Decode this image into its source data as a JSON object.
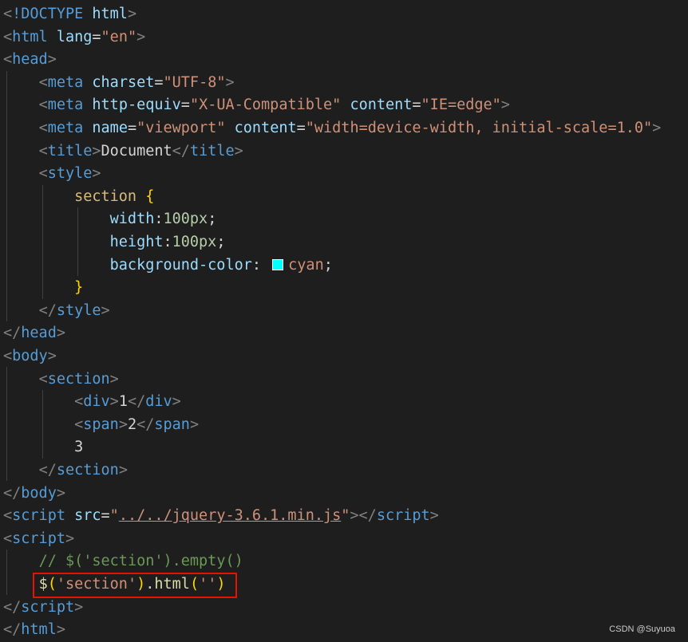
{
  "editor": {
    "lines": [
      {
        "indent": 0,
        "tokens": [
          {
            "t": "<",
            "c": "#808080"
          },
          {
            "t": "!DOCTYPE",
            "c": "#569cd6"
          },
          {
            "t": " ",
            "c": "#d4d4d4"
          },
          {
            "t": "html",
            "c": "#9cdcfe"
          },
          {
            "t": ">",
            "c": "#808080"
          }
        ]
      },
      {
        "indent": 0,
        "tokens": [
          {
            "t": "<",
            "c": "#808080"
          },
          {
            "t": "html",
            "c": "#569cd6"
          },
          {
            "t": " ",
            "c": "#d4d4d4"
          },
          {
            "t": "lang",
            "c": "#9cdcfe"
          },
          {
            "t": "=",
            "c": "#d4d4d4"
          },
          {
            "t": "\"en\"",
            "c": "#ce9178"
          },
          {
            "t": ">",
            "c": "#808080"
          }
        ]
      },
      {
        "indent": 0,
        "tokens": [
          {
            "t": "<",
            "c": "#808080"
          },
          {
            "t": "head",
            "c": "#569cd6"
          },
          {
            "t": ">",
            "c": "#808080"
          }
        ]
      },
      {
        "indent": 4,
        "tokens": [
          {
            "t": "<",
            "c": "#808080"
          },
          {
            "t": "meta",
            "c": "#569cd6"
          },
          {
            "t": " ",
            "c": "#d4d4d4"
          },
          {
            "t": "charset",
            "c": "#9cdcfe"
          },
          {
            "t": "=",
            "c": "#d4d4d4"
          },
          {
            "t": "\"UTF-8\"",
            "c": "#ce9178"
          },
          {
            "t": ">",
            "c": "#808080"
          }
        ]
      },
      {
        "indent": 4,
        "tokens": [
          {
            "t": "<",
            "c": "#808080"
          },
          {
            "t": "meta",
            "c": "#569cd6"
          },
          {
            "t": " ",
            "c": "#d4d4d4"
          },
          {
            "t": "http-equiv",
            "c": "#9cdcfe"
          },
          {
            "t": "=",
            "c": "#d4d4d4"
          },
          {
            "t": "\"X-UA-Compatible\"",
            "c": "#ce9178"
          },
          {
            "t": " ",
            "c": "#d4d4d4"
          },
          {
            "t": "content",
            "c": "#9cdcfe"
          },
          {
            "t": "=",
            "c": "#d4d4d4"
          },
          {
            "t": "\"IE=edge\"",
            "c": "#ce9178"
          },
          {
            "t": ">",
            "c": "#808080"
          }
        ]
      },
      {
        "indent": 4,
        "tokens": [
          {
            "t": "<",
            "c": "#808080"
          },
          {
            "t": "meta",
            "c": "#569cd6"
          },
          {
            "t": " ",
            "c": "#d4d4d4"
          },
          {
            "t": "name",
            "c": "#9cdcfe"
          },
          {
            "t": "=",
            "c": "#d4d4d4"
          },
          {
            "t": "\"viewport\"",
            "c": "#ce9178"
          },
          {
            "t": " ",
            "c": "#d4d4d4"
          },
          {
            "t": "content",
            "c": "#9cdcfe"
          },
          {
            "t": "=",
            "c": "#d4d4d4"
          },
          {
            "t": "\"width=device-width, initial-scale=1.0\"",
            "c": "#ce9178"
          },
          {
            "t": ">",
            "c": "#808080"
          }
        ]
      },
      {
        "indent": 4,
        "tokens": [
          {
            "t": "<",
            "c": "#808080"
          },
          {
            "t": "title",
            "c": "#569cd6"
          },
          {
            "t": ">",
            "c": "#808080"
          },
          {
            "t": "Document",
            "c": "#d4d4d4"
          },
          {
            "t": "</",
            "c": "#808080"
          },
          {
            "t": "title",
            "c": "#569cd6"
          },
          {
            "t": ">",
            "c": "#808080"
          }
        ]
      },
      {
        "indent": 4,
        "tokens": [
          {
            "t": "<",
            "c": "#808080"
          },
          {
            "t": "style",
            "c": "#569cd6"
          },
          {
            "t": ">",
            "c": "#808080"
          }
        ]
      },
      {
        "indent": 8,
        "tokens": [
          {
            "t": "section",
            "c": "#d7ba7d"
          },
          {
            "t": " ",
            "c": "#d4d4d4"
          },
          {
            "t": "{",
            "c": "#ffd700"
          }
        ]
      },
      {
        "indent": 12,
        "tokens": [
          {
            "t": "width",
            "c": "#9cdcfe"
          },
          {
            "t": ":",
            "c": "#d4d4d4"
          },
          {
            "t": "100",
            "c": "#b5cea8"
          },
          {
            "t": "px",
            "c": "#b5cea8"
          },
          {
            "t": ";",
            "c": "#d4d4d4"
          }
        ]
      },
      {
        "indent": 12,
        "tokens": [
          {
            "t": "height",
            "c": "#9cdcfe"
          },
          {
            "t": ":",
            "c": "#d4d4d4"
          },
          {
            "t": "100",
            "c": "#b5cea8"
          },
          {
            "t": "px",
            "c": "#b5cea8"
          },
          {
            "t": ";",
            "c": "#d4d4d4"
          }
        ]
      },
      {
        "indent": 12,
        "tokens": [
          {
            "t": "background-color",
            "c": "#9cdcfe"
          },
          {
            "t": ": ",
            "c": "#d4d4d4"
          },
          {
            "swatch": "#00ffff"
          },
          {
            "t": "cyan",
            "c": "#ce9178"
          },
          {
            "t": ";",
            "c": "#d4d4d4"
          }
        ]
      },
      {
        "indent": 8,
        "tokens": [
          {
            "t": "}",
            "c": "#ffd700"
          }
        ]
      },
      {
        "indent": 4,
        "tokens": [
          {
            "t": "</",
            "c": "#808080"
          },
          {
            "t": "style",
            "c": "#569cd6"
          },
          {
            "t": ">",
            "c": "#808080"
          }
        ]
      },
      {
        "indent": 0,
        "tokens": [
          {
            "t": "</",
            "c": "#808080"
          },
          {
            "t": "head",
            "c": "#569cd6"
          },
          {
            "t": ">",
            "c": "#808080"
          }
        ]
      },
      {
        "indent": 0,
        "tokens": [
          {
            "t": "<",
            "c": "#808080"
          },
          {
            "t": "body",
            "c": "#569cd6"
          },
          {
            "t": ">",
            "c": "#808080"
          }
        ]
      },
      {
        "indent": 4,
        "tokens": [
          {
            "t": "<",
            "c": "#808080"
          },
          {
            "t": "section",
            "c": "#569cd6"
          },
          {
            "t": ">",
            "c": "#808080"
          }
        ]
      },
      {
        "indent": 8,
        "tokens": [
          {
            "t": "<",
            "c": "#808080"
          },
          {
            "t": "div",
            "c": "#569cd6"
          },
          {
            "t": ">",
            "c": "#808080"
          },
          {
            "t": "1",
            "c": "#d4d4d4"
          },
          {
            "t": "</",
            "c": "#808080"
          },
          {
            "t": "div",
            "c": "#569cd6"
          },
          {
            "t": ">",
            "c": "#808080"
          }
        ]
      },
      {
        "indent": 8,
        "tokens": [
          {
            "t": "<",
            "c": "#808080"
          },
          {
            "t": "span",
            "c": "#569cd6"
          },
          {
            "t": ">",
            "c": "#808080"
          },
          {
            "t": "2",
            "c": "#d4d4d4"
          },
          {
            "t": "</",
            "c": "#808080"
          },
          {
            "t": "span",
            "c": "#569cd6"
          },
          {
            "t": ">",
            "c": "#808080"
          }
        ]
      },
      {
        "indent": 8,
        "tokens": [
          {
            "t": "3",
            "c": "#d4d4d4"
          }
        ]
      },
      {
        "indent": 4,
        "tokens": [
          {
            "t": "</",
            "c": "#808080"
          },
          {
            "t": "section",
            "c": "#569cd6"
          },
          {
            "t": ">",
            "c": "#808080"
          }
        ]
      },
      {
        "indent": 0,
        "tokens": [
          {
            "t": "</",
            "c": "#808080"
          },
          {
            "t": "body",
            "c": "#569cd6"
          },
          {
            "t": ">",
            "c": "#808080"
          }
        ]
      },
      {
        "indent": 0,
        "tokens": [
          {
            "t": "<",
            "c": "#808080"
          },
          {
            "t": "script",
            "c": "#569cd6"
          },
          {
            "t": " ",
            "c": "#d4d4d4"
          },
          {
            "t": "src",
            "c": "#9cdcfe"
          },
          {
            "t": "=",
            "c": "#d4d4d4"
          },
          {
            "t": "\"",
            "c": "#ce9178"
          },
          {
            "t": "../../jquery-3.6.1.min.js",
            "c": "#ce9178",
            "link": true
          },
          {
            "t": "\"",
            "c": "#ce9178"
          },
          {
            "t": "></",
            "c": "#808080"
          },
          {
            "t": "script",
            "c": "#569cd6"
          },
          {
            "t": ">",
            "c": "#808080"
          }
        ]
      },
      {
        "indent": 0,
        "tokens": [
          {
            "t": "<",
            "c": "#808080"
          },
          {
            "t": "script",
            "c": "#569cd6"
          },
          {
            "t": ">",
            "c": "#808080"
          }
        ]
      },
      {
        "indent": 4,
        "tokens": [
          {
            "t": "// $('section').empty()",
            "c": "#6a9955"
          }
        ]
      },
      {
        "indent": 4,
        "highlight": true,
        "tokens": [
          {
            "t": "$",
            "c": "#dcdcaa"
          },
          {
            "t": "(",
            "c": "#ffd700"
          },
          {
            "t": "'section'",
            "c": "#ce9178"
          },
          {
            "t": ")",
            "c": "#ffd700"
          },
          {
            "t": ".",
            "c": "#d4d4d4"
          },
          {
            "t": "html",
            "c": "#dcdcaa"
          },
          {
            "t": "(",
            "c": "#ffd700"
          },
          {
            "t": "''",
            "c": "#ce9178"
          },
          {
            "t": ")",
            "c": "#ffd700"
          }
        ]
      },
      {
        "indent": 0,
        "tokens": [
          {
            "t": "</",
            "c": "#808080"
          },
          {
            "t": "script",
            "c": "#569cd6"
          },
          {
            "t": ">",
            "c": "#808080"
          }
        ]
      },
      {
        "indent": 0,
        "tokens": [
          {
            "t": "</",
            "c": "#808080"
          },
          {
            "t": "html",
            "c": "#569cd6"
          },
          {
            "t": ">",
            "c": "#808080"
          }
        ]
      }
    ]
  },
  "watermark": "CSDN @Suyuoa"
}
